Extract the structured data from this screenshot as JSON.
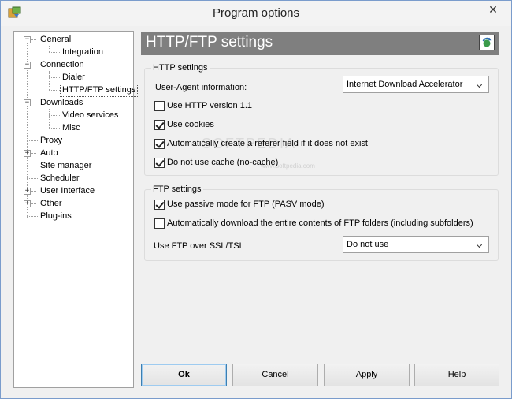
{
  "window": {
    "title": "Program options"
  },
  "tree": {
    "items": [
      {
        "label": "General"
      },
      {
        "label": "Integration"
      },
      {
        "label": "Connection"
      },
      {
        "label": "Dialer"
      },
      {
        "label": "HTTP/FTP settings"
      },
      {
        "label": "Downloads"
      },
      {
        "label": "Video services"
      },
      {
        "label": "Misc"
      },
      {
        "label": "Proxy"
      },
      {
        "label": "Auto"
      },
      {
        "label": "Site manager"
      },
      {
        "label": "Scheduler"
      },
      {
        "label": "User Interface"
      },
      {
        "label": "Other"
      },
      {
        "label": "Plug-ins"
      }
    ],
    "selected": "HTTP/FTP settings"
  },
  "panel": {
    "title": "HTTP/FTP settings"
  },
  "http": {
    "group_title": "HTTP settings",
    "user_agent_label": "User-Agent information:",
    "user_agent_value": "Internet Download Accelerator",
    "checkboxes": [
      {
        "label": "Use HTTP version 1.1",
        "checked": false
      },
      {
        "label": "Use cookies",
        "checked": true
      },
      {
        "label": "Automatically create a referer field if it does not exist",
        "checked": true
      },
      {
        "label": "Do not use cache (no-cache)",
        "checked": true
      }
    ]
  },
  "ftp": {
    "group_title": "FTP settings",
    "checkboxes": [
      {
        "label": "Use passive mode for FTP (PASV mode)",
        "checked": true
      },
      {
        "label": "Automatically download the entire contents of FTP folders (including subfolders)",
        "checked": false
      }
    ],
    "ssl_label": "Use FTP over SSL/TSL",
    "ssl_value": "Do not use"
  },
  "buttons": {
    "ok": "Ok",
    "cancel": "Cancel",
    "apply": "Apply",
    "help": "Help"
  },
  "watermark": {
    "main": "SOFTPEDIA",
    "sub": "www.softpedia.com"
  }
}
